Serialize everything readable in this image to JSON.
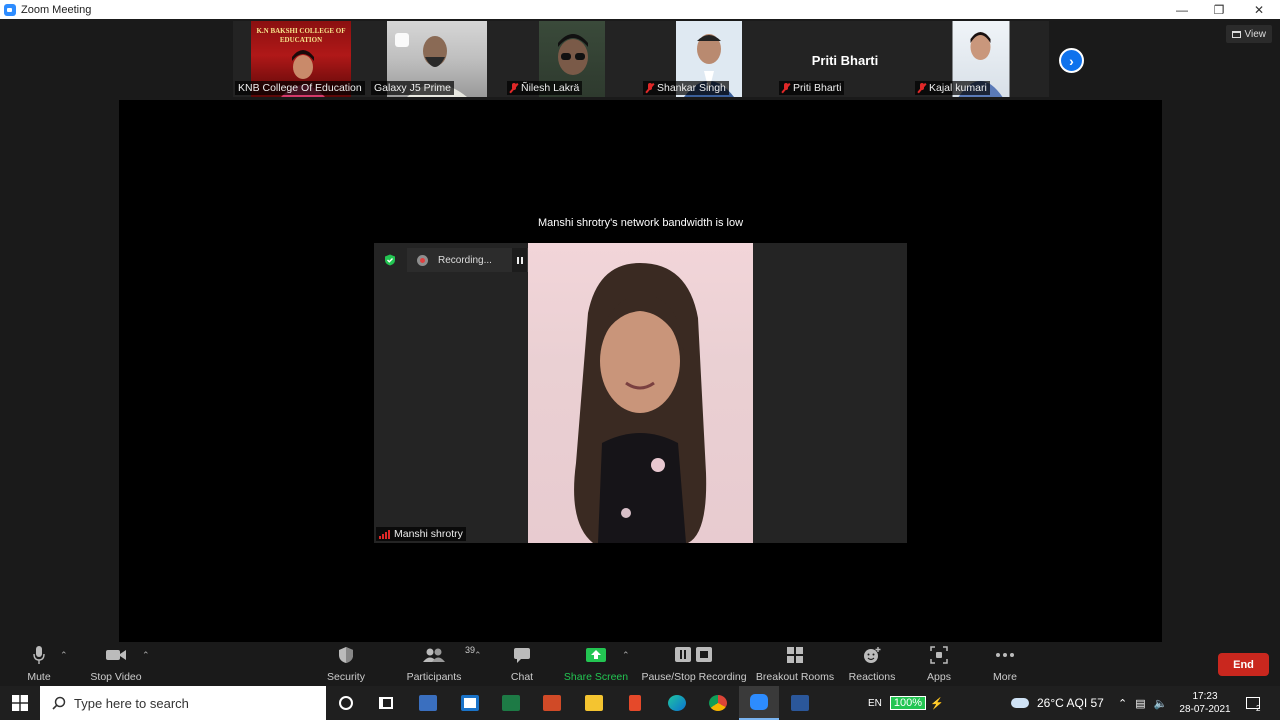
{
  "window": {
    "title": "Zoom Meeting"
  },
  "view_label": "View",
  "participants_strip": [
    {
      "name": "KNB College Of Education",
      "muted": false,
      "banner_text": "K.N BAKSHI COLLEGE OF EDUCATION"
    },
    {
      "name": "Galaxy J5 Prime",
      "muted": false
    },
    {
      "name": "Ñilesh Lakrä",
      "muted": true
    },
    {
      "name": "Shankar Singh",
      "muted": true
    },
    {
      "name": "Priti Bharti",
      "muted": true,
      "display_name": "Priti Bharti"
    },
    {
      "name": "Kajal kumari",
      "muted": true
    }
  ],
  "main_stage": {
    "bandwidth_notice": "Manshi shrotry's network bandwidth is low",
    "recording_label": "Recording...",
    "speaker_name": "Manshi shrotry"
  },
  "toolbar": {
    "mute": "Mute",
    "stop_video": "Stop Video",
    "security": "Security",
    "participants": "Participants",
    "participants_count": "39",
    "chat": "Chat",
    "share_screen": "Share Screen",
    "pause_stop_recording": "Pause/Stop Recording",
    "breakout_rooms": "Breakout Rooms",
    "reactions": "Reactions",
    "apps": "Apps",
    "more": "More",
    "end": "End"
  },
  "colors": {
    "accent": "#2D8CFF",
    "share_green": "#23c552",
    "end_red": "#c9271e",
    "muted_red": "#e02828"
  },
  "taskbar": {
    "search_placeholder": "Type here to search",
    "weather": "26°C  AQI 57",
    "lang": "EN",
    "battery": "100%",
    "time": "17:23",
    "date": "28-07-2021",
    "notification_count": "2"
  }
}
